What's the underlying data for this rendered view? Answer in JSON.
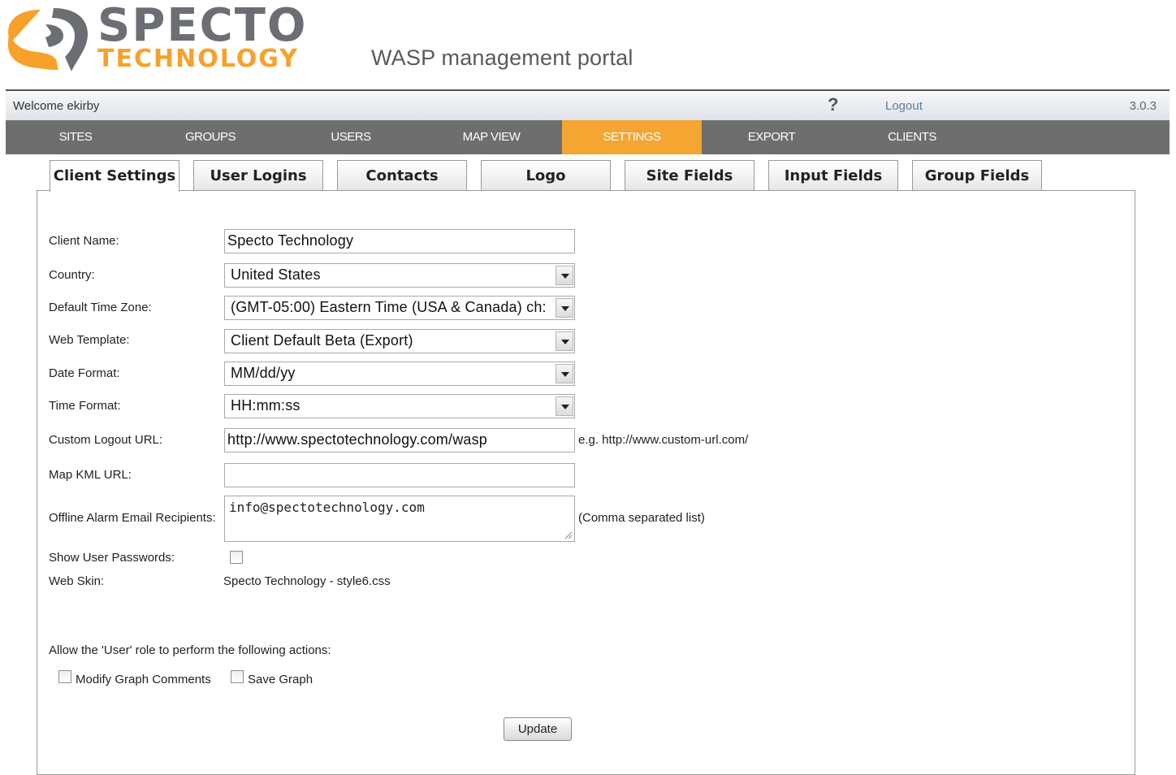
{
  "brand": {
    "name_line1": "SPECTO",
    "name_line2": "TECHNOLOGY",
    "accent": "#f7a12a",
    "gray": "#6b6e73"
  },
  "portal_title": "WASP management portal",
  "welcome_bar": {
    "welcome": "Welcome ekirby",
    "help_icon": "?",
    "logout": "Logout",
    "version": "3.0.3"
  },
  "main_nav": {
    "items": [
      "SITES",
      "GROUPS",
      "USERS",
      "MAP VIEW",
      "SETTINGS",
      "EXPORT",
      "CLIENTS"
    ],
    "active": "SETTINGS",
    "bg_color": "#6e6e6e",
    "active_color": "#f5a532"
  },
  "tabs": {
    "items": [
      "Client Settings",
      "User Logins",
      "Contacts",
      "Logo",
      "Site Fields",
      "Input Fields",
      "Group Fields"
    ],
    "active": "Client Settings"
  },
  "form": {
    "client_name": {
      "label": "Client Name:",
      "value": "Specto Technology"
    },
    "country": {
      "label": "Country:",
      "value": "United States"
    },
    "time_zone": {
      "label": "Default Time Zone:",
      "value": "(GMT-05:00) Eastern Time (USA & Canada) ch:"
    },
    "web_template": {
      "label": "Web Template:",
      "value": "Client Default Beta (Export)"
    },
    "date_format": {
      "label": "Date Format:",
      "value": "MM/dd/yy"
    },
    "time_format": {
      "label": "Time Format:",
      "value": "HH:mm:ss"
    },
    "logout_url": {
      "label": "Custom Logout URL:",
      "value": "http://www.spectotechnology.com/wasp",
      "hint": "e.g. http://www.custom-url.com/"
    },
    "map_kml_url": {
      "label": "Map KML URL:",
      "value": ""
    },
    "alarm_recipients": {
      "label": "Offline Alarm Email Recipients:",
      "value": "info@spectotechnology.com",
      "hint": "(Comma separated list)"
    },
    "show_passwords": {
      "label": "Show User Passwords:",
      "checked": false
    },
    "web_skin": {
      "label": "Web Skin:",
      "value": "Specto Technology - style6.css"
    },
    "user_role_intro": "Allow the 'User' role to perform the following actions:",
    "modify_graph_comments": {
      "label": "Modify Graph Comments",
      "checked": false
    },
    "save_graph": {
      "label": "Save Graph",
      "checked": false
    },
    "update_button": "Update"
  }
}
